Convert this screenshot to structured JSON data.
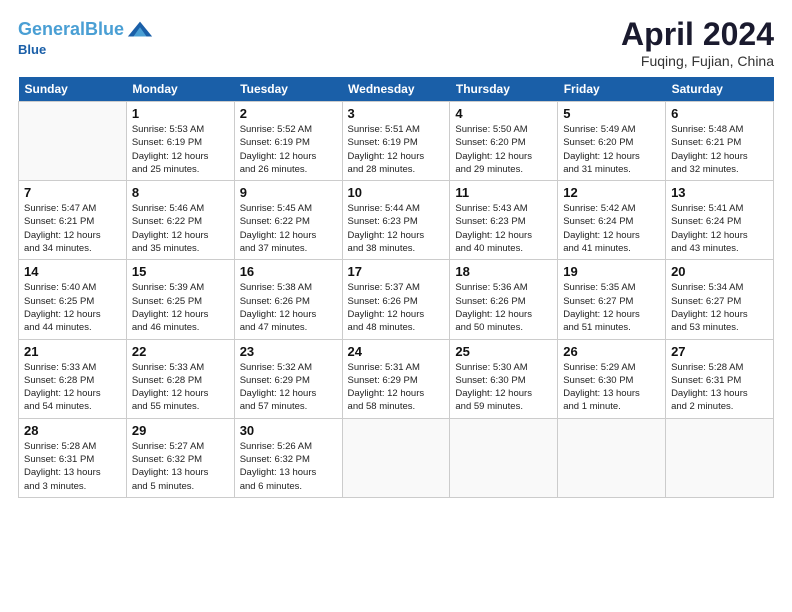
{
  "header": {
    "logo_line1": "General",
    "logo_line2": "Blue",
    "month_title": "April 2024",
    "location": "Fuqing, Fujian, China"
  },
  "days_of_week": [
    "Sunday",
    "Monday",
    "Tuesday",
    "Wednesday",
    "Thursday",
    "Friday",
    "Saturday"
  ],
  "weeks": [
    [
      {
        "day": "",
        "info": ""
      },
      {
        "day": "1",
        "info": "Sunrise: 5:53 AM\nSunset: 6:19 PM\nDaylight: 12 hours\nand 25 minutes."
      },
      {
        "day": "2",
        "info": "Sunrise: 5:52 AM\nSunset: 6:19 PM\nDaylight: 12 hours\nand 26 minutes."
      },
      {
        "day": "3",
        "info": "Sunrise: 5:51 AM\nSunset: 6:19 PM\nDaylight: 12 hours\nand 28 minutes."
      },
      {
        "day": "4",
        "info": "Sunrise: 5:50 AM\nSunset: 6:20 PM\nDaylight: 12 hours\nand 29 minutes."
      },
      {
        "day": "5",
        "info": "Sunrise: 5:49 AM\nSunset: 6:20 PM\nDaylight: 12 hours\nand 31 minutes."
      },
      {
        "day": "6",
        "info": "Sunrise: 5:48 AM\nSunset: 6:21 PM\nDaylight: 12 hours\nand 32 minutes."
      }
    ],
    [
      {
        "day": "7",
        "info": "Sunrise: 5:47 AM\nSunset: 6:21 PM\nDaylight: 12 hours\nand 34 minutes."
      },
      {
        "day": "8",
        "info": "Sunrise: 5:46 AM\nSunset: 6:22 PM\nDaylight: 12 hours\nand 35 minutes."
      },
      {
        "day": "9",
        "info": "Sunrise: 5:45 AM\nSunset: 6:22 PM\nDaylight: 12 hours\nand 37 minutes."
      },
      {
        "day": "10",
        "info": "Sunrise: 5:44 AM\nSunset: 6:23 PM\nDaylight: 12 hours\nand 38 minutes."
      },
      {
        "day": "11",
        "info": "Sunrise: 5:43 AM\nSunset: 6:23 PM\nDaylight: 12 hours\nand 40 minutes."
      },
      {
        "day": "12",
        "info": "Sunrise: 5:42 AM\nSunset: 6:24 PM\nDaylight: 12 hours\nand 41 minutes."
      },
      {
        "day": "13",
        "info": "Sunrise: 5:41 AM\nSunset: 6:24 PM\nDaylight: 12 hours\nand 43 minutes."
      }
    ],
    [
      {
        "day": "14",
        "info": "Sunrise: 5:40 AM\nSunset: 6:25 PM\nDaylight: 12 hours\nand 44 minutes."
      },
      {
        "day": "15",
        "info": "Sunrise: 5:39 AM\nSunset: 6:25 PM\nDaylight: 12 hours\nand 46 minutes."
      },
      {
        "day": "16",
        "info": "Sunrise: 5:38 AM\nSunset: 6:26 PM\nDaylight: 12 hours\nand 47 minutes."
      },
      {
        "day": "17",
        "info": "Sunrise: 5:37 AM\nSunset: 6:26 PM\nDaylight: 12 hours\nand 48 minutes."
      },
      {
        "day": "18",
        "info": "Sunrise: 5:36 AM\nSunset: 6:26 PM\nDaylight: 12 hours\nand 50 minutes."
      },
      {
        "day": "19",
        "info": "Sunrise: 5:35 AM\nSunset: 6:27 PM\nDaylight: 12 hours\nand 51 minutes."
      },
      {
        "day": "20",
        "info": "Sunrise: 5:34 AM\nSunset: 6:27 PM\nDaylight: 12 hours\nand 53 minutes."
      }
    ],
    [
      {
        "day": "21",
        "info": "Sunrise: 5:33 AM\nSunset: 6:28 PM\nDaylight: 12 hours\nand 54 minutes."
      },
      {
        "day": "22",
        "info": "Sunrise: 5:33 AM\nSunset: 6:28 PM\nDaylight: 12 hours\nand 55 minutes."
      },
      {
        "day": "23",
        "info": "Sunrise: 5:32 AM\nSunset: 6:29 PM\nDaylight: 12 hours\nand 57 minutes."
      },
      {
        "day": "24",
        "info": "Sunrise: 5:31 AM\nSunset: 6:29 PM\nDaylight: 12 hours\nand 58 minutes."
      },
      {
        "day": "25",
        "info": "Sunrise: 5:30 AM\nSunset: 6:30 PM\nDaylight: 12 hours\nand 59 minutes."
      },
      {
        "day": "26",
        "info": "Sunrise: 5:29 AM\nSunset: 6:30 PM\nDaylight: 13 hours\nand 1 minute."
      },
      {
        "day": "27",
        "info": "Sunrise: 5:28 AM\nSunset: 6:31 PM\nDaylight: 13 hours\nand 2 minutes."
      }
    ],
    [
      {
        "day": "28",
        "info": "Sunrise: 5:28 AM\nSunset: 6:31 PM\nDaylight: 13 hours\nand 3 minutes."
      },
      {
        "day": "29",
        "info": "Sunrise: 5:27 AM\nSunset: 6:32 PM\nDaylight: 13 hours\nand 5 minutes."
      },
      {
        "day": "30",
        "info": "Sunrise: 5:26 AM\nSunset: 6:32 PM\nDaylight: 13 hours\nand 6 minutes."
      },
      {
        "day": "",
        "info": ""
      },
      {
        "day": "",
        "info": ""
      },
      {
        "day": "",
        "info": ""
      },
      {
        "day": "",
        "info": ""
      }
    ]
  ]
}
